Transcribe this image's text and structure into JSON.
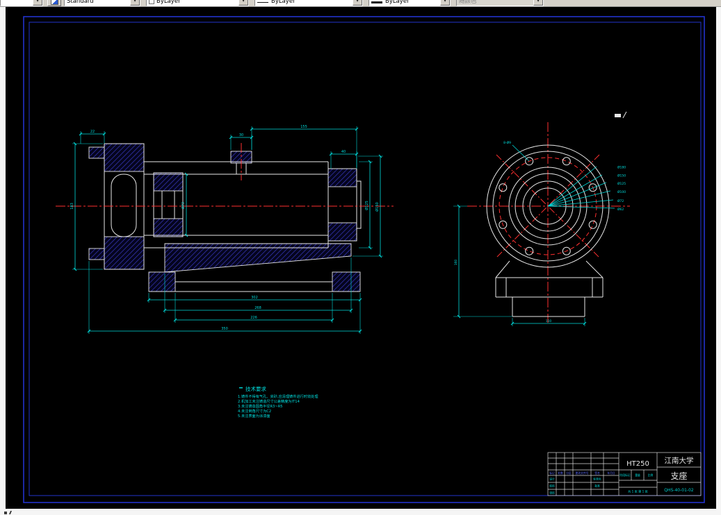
{
  "toolbar": {
    "style": "Standard",
    "color": "ByLayer",
    "linetype": "ByLayer",
    "lineweight": "ByLayer",
    "plot_style": "随颜色",
    "chevron": "▼"
  },
  "front": {
    "dims": {
      "top_width": "155",
      "boss_width": "30",
      "left_step": "22",
      "flange_width": "40",
      "flange_height": "183",
      "bore": "Ø72",
      "dia_right1": "Ø125",
      "dia_right2": "Ø150",
      "base_width": "302",
      "rib_width": "268",
      "inner_width": "226",
      "overall": "350"
    }
  },
  "side": {
    "dims": {
      "fan": [
        "Ø180",
        "Ø150",
        "Ø125",
        "Ø100",
        "Ø72",
        "Ø62"
      ],
      "holes": "8-Ø9",
      "height": "160",
      "base": "110"
    }
  },
  "notes": {
    "title": "技术要求",
    "lines": [
      "1.铸件不得有气孔、夹砂,应清理铸件进行时效处理",
      "2.机加工未注铸造尺寸公差精度为IT14",
      "3.未注铸造圆角半径R3~R5",
      "4.未注倒角尺寸为C2",
      "5.未注表面为涂漆面"
    ]
  },
  "title_block": {
    "material": "HT250",
    "org": "江南大学",
    "part": "支座",
    "drawing_no": "QHS-40-01-02",
    "rev_header": [
      "标记",
      "处数",
      "分区",
      "更改文件号",
      "签名",
      "年月日"
    ],
    "sign_labels": [
      "设计",
      "校核",
      "审核"
    ],
    "approve_labels": [
      "标准化",
      "批准"
    ],
    "stage_header": [
      "阶段标记",
      "重量",
      "比例"
    ],
    "sheet": "共 1 张 第 1 张"
  }
}
